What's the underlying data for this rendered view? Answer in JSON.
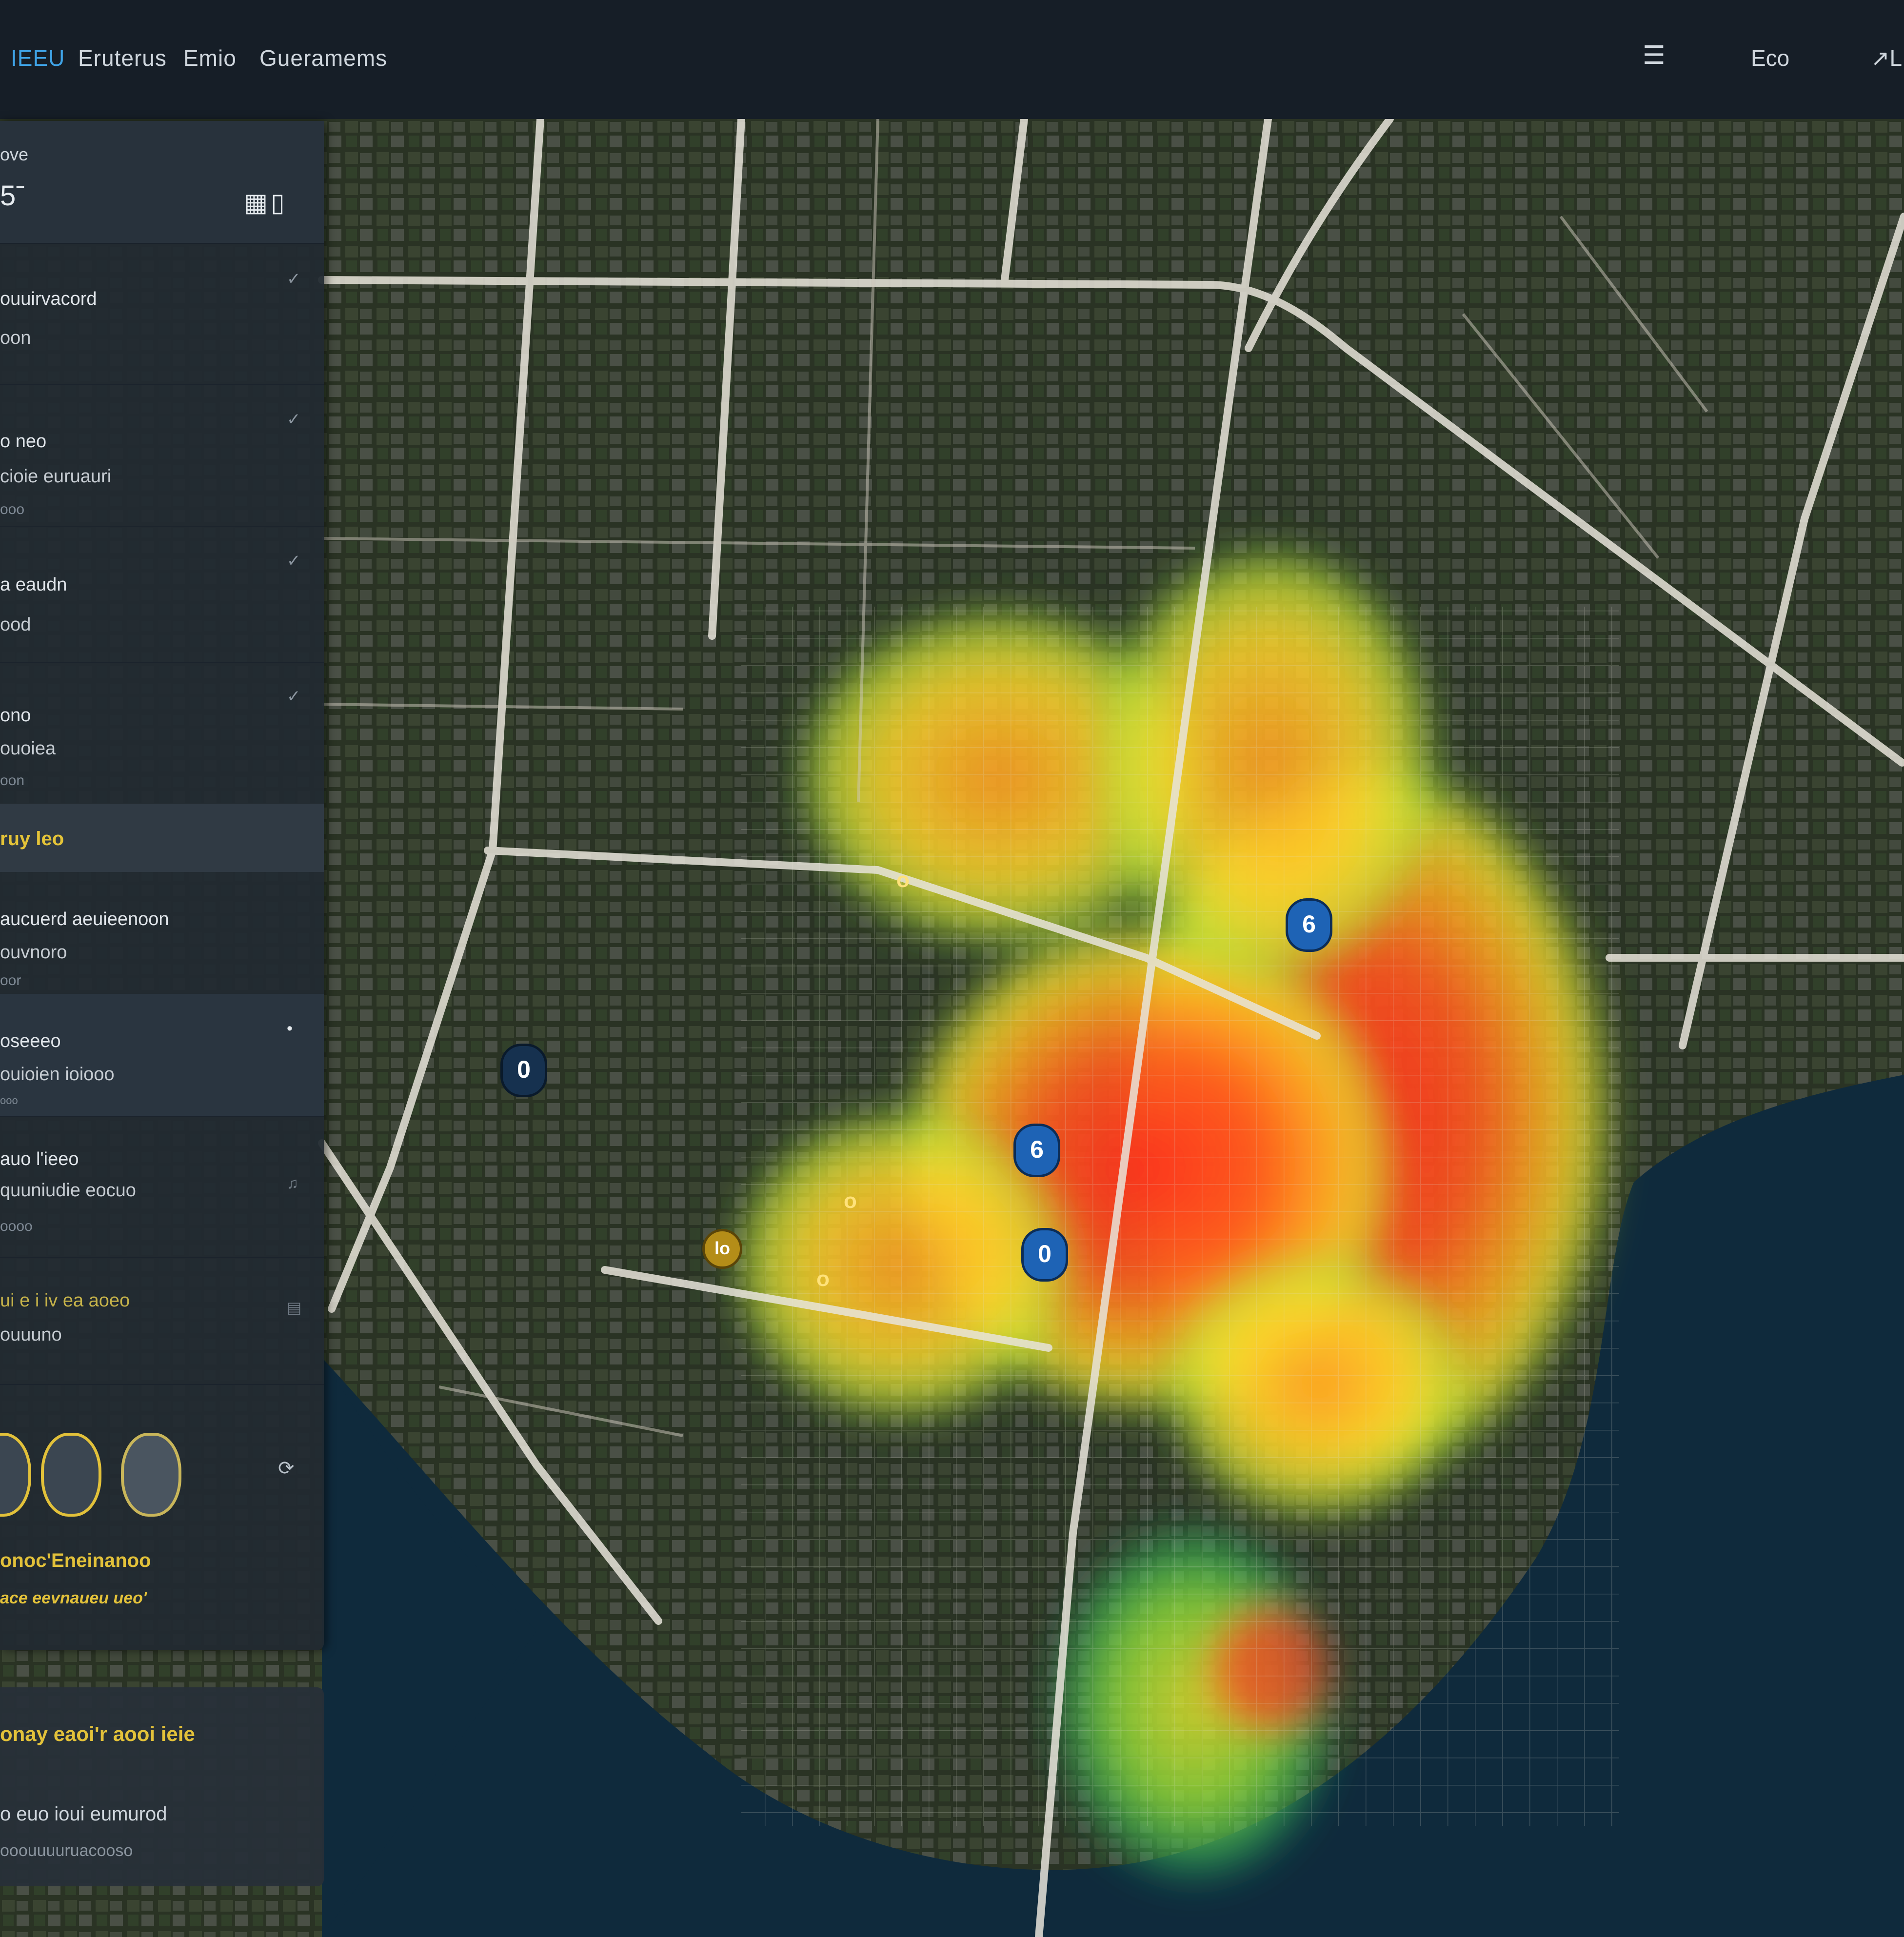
{
  "nav": {
    "items": [
      {
        "label": "IEEU",
        "active": true
      },
      {
        "label": "Eruterus",
        "active": false
      },
      {
        "label": "Emio",
        "active": false
      },
      {
        "label": "Gueramems",
        "active": false
      }
    ],
    "right_icon": "layers-icon",
    "right_label": "Eco",
    "user_label": "↗L"
  },
  "sidebar": {
    "header": {
      "caption": "ove",
      "value": "5ˉ",
      "icon": "grid-icon",
      "icon_glyph": "▦▯"
    },
    "items": [
      {
        "l1": "ouuirvacord",
        "l2": "oon",
        "l3": ""
      },
      {
        "l1": "o neo",
        "l2": "cioie euruauri",
        "l3": "ooo"
      },
      {
        "l1": "a eaudn",
        "l2": "ood",
        "l3": ""
      },
      {
        "l1": "ono",
        "l2": "ouoiea",
        "l3": "oon"
      }
    ],
    "section_label": "ruy leo",
    "alerts": [
      {
        "l1": "aucuerd aeuieenoon",
        "l2": "ouvnoro",
        "l3": "oor"
      },
      {
        "l1": "oseeeo",
        "l2": "ouioien ioiooo",
        "l3": "ooo"
      },
      {
        "l1": "auo l'ieeo",
        "l2": "quuniudie eocuo",
        "l3": "oooo"
      },
      {
        "l1": "ui e i iv ea aoeo",
        "l2": "ouuuno",
        "l3": ""
      }
    ],
    "avatars_caption_1": "onoc'Eneinanoo",
    "avatars_caption_2": "ace eevnaueu ueo'",
    "card": {
      "title": "onay eaoi'r aooi ieie",
      "line": "o euo ioui eumurod",
      "sub": "ooouuuuruacooso"
    }
  },
  "markers": {
    "pins": [
      "0",
      "6",
      "6",
      "0"
    ],
    "small_labels": [
      "o",
      "lo",
      "o",
      "o"
    ]
  },
  "colors": {
    "topbar": "#161e27",
    "accent": "#3fa3e6",
    "yellow": "#e2c13a",
    "water": "#0f2a3c",
    "land": "#2e3a26"
  }
}
